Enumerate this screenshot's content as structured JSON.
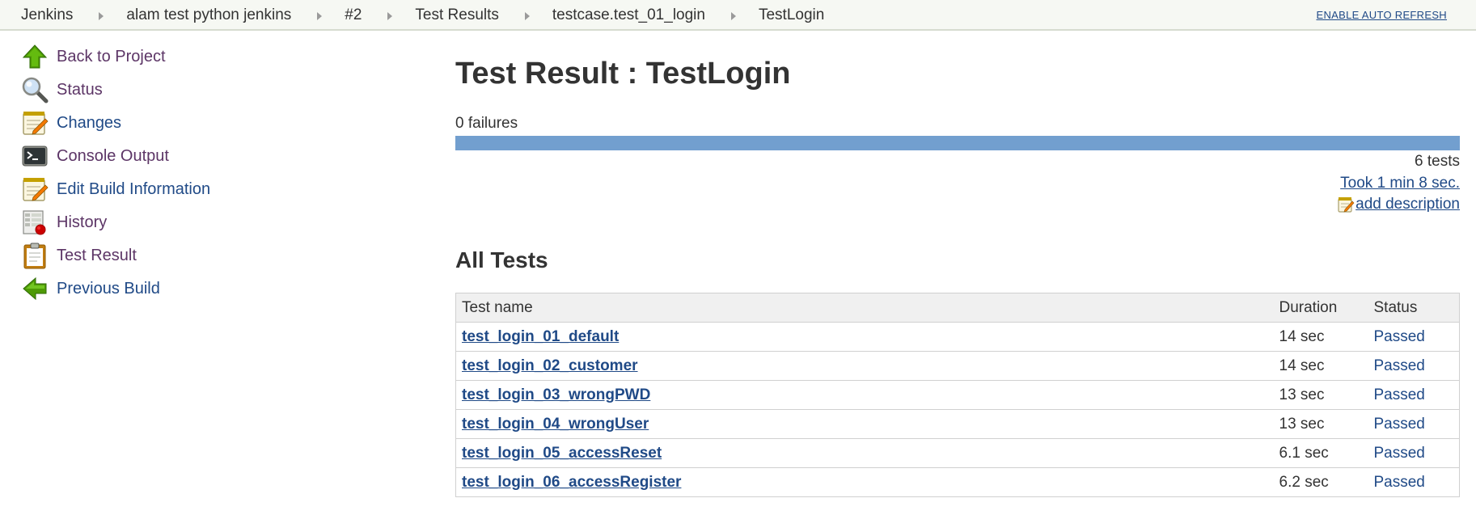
{
  "breadcrumbs": [
    {
      "label": "Jenkins"
    },
    {
      "label": "alam test python jenkins"
    },
    {
      "label": "#2"
    },
    {
      "label": "Test Results"
    },
    {
      "label": "testcase.test_01_login"
    },
    {
      "label": "TestLogin"
    }
  ],
  "header": {
    "auto_refresh": "ENABLE AUTO REFRESH"
  },
  "sidebar": {
    "items": [
      {
        "label": "Back to Project",
        "icon": "up-arrow-icon"
      },
      {
        "label": "Status",
        "icon": "magnifier-icon"
      },
      {
        "label": "Changes",
        "icon": "notepad-icon"
      },
      {
        "label": "Console Output",
        "icon": "terminal-icon"
      },
      {
        "label": "Edit Build Information",
        "icon": "notepad-icon"
      },
      {
        "label": "History",
        "icon": "history-icon"
      },
      {
        "label": "Test Result",
        "icon": "clipboard-icon"
      },
      {
        "label": "Previous Build",
        "icon": "left-arrow-icon"
      }
    ]
  },
  "main": {
    "title": "Test Result : TestLogin",
    "failures": "0 failures",
    "progress_passed_fraction": 1.0,
    "test_count": "6 tests",
    "took": "Took 1 min 8 sec.",
    "add_description": "add description",
    "all_tests_heading": "All Tests",
    "table": {
      "headers": {
        "name": "Test name",
        "duration": "Duration",
        "status": "Status"
      },
      "rows": [
        {
          "name": "test_login_01_default",
          "duration": "14 sec",
          "status": "Passed"
        },
        {
          "name": "test_login_02_customer",
          "duration": "14 sec",
          "status": "Passed"
        },
        {
          "name": "test_login_03_wrongPWD",
          "duration": "13 sec",
          "status": "Passed"
        },
        {
          "name": "test_login_04_wrongUser",
          "duration": "13 sec",
          "status": "Passed"
        },
        {
          "name": "test_login_05_accessReset",
          "duration": "6.1 sec",
          "status": "Passed"
        },
        {
          "name": "test_login_06_accessRegister",
          "duration": "6.2 sec",
          "status": "Passed"
        }
      ]
    }
  },
  "colors": {
    "link": "#204a87",
    "visited_link": "#5c3566",
    "progress_pass": "#729fcf",
    "breadcrumb_bg": "#f6f8f3"
  }
}
